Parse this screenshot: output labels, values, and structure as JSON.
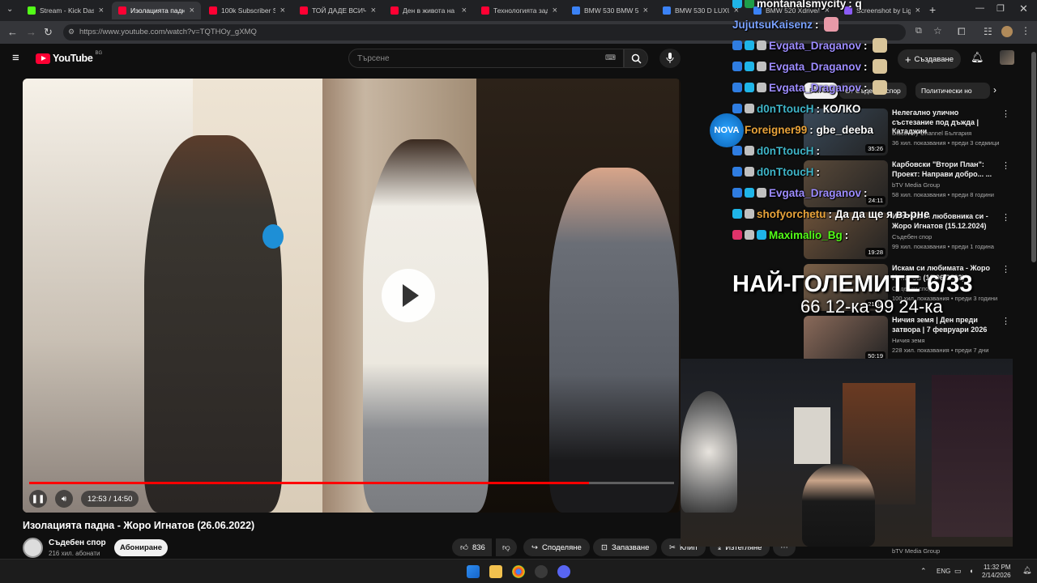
{
  "browser": {
    "tabs": [
      {
        "title": "Stream - Kick Dashb",
        "color": "#53fc18"
      },
      {
        "title": "Изолацията падна",
        "color": "#ff0033"
      },
      {
        "title": "100k Subscriber Spe",
        "color": "#ff0033"
      },
      {
        "title": "ТОЙ ДАДЕ ВСИЧКО",
        "color": "#ff0033"
      },
      {
        "title": "Ден в живота на 22",
        "color": "#ff0033"
      },
      {
        "title": "Технологията зад U",
        "color": "#ff0033"
      },
      {
        "title": "BMW 530 BMW 530",
        "color": "#3b82f6"
      },
      {
        "title": "BMW 530 D LUXURY",
        "color": "#3b82f6"
      },
      {
        "title": "BMW 520 Xdrive/N",
        "color": "#3b82f6"
      },
      {
        "title": "Screenshot by Light",
        "color": "#8b5cf6"
      }
    ],
    "url": "https://www.youtube.com/watch?v=TQTHOy_gXMQ"
  },
  "youtube": {
    "logo_text": "YouTube",
    "logo_region": "BG",
    "search_placeholder": "Търсене",
    "create_label": "Създаване"
  },
  "video": {
    "time": "12:53 / 14:50",
    "progress_fraction": 0.868,
    "title": "Изолацията падна - Жоро Игнатов (26.06.2022)",
    "channel": "Съдебен спор",
    "subscribers": "216 хил. абонати",
    "subscribe_label": "Абониране",
    "likes": "836",
    "share_label": "Споделяне",
    "save_label": "Запазване",
    "clip_label": "Клип",
    "download_label": "Изтегляне"
  },
  "chips": [
    "Всички",
    "От Съдебен спор",
    "Политически но"
  ],
  "recommendations": [
    {
      "title": "Нелегално улично състезание под дъжда | Катаджии",
      "channel": "Discovery Channel България",
      "meta": "36 хил. показвания • преди 3 седмици",
      "duration": "35:26",
      "thumb": "#3a4a5a"
    },
    {
      "title": "Карбовски \"Втори План\": Проект: Направи добро... ...",
      "channel": "bTV Media Group",
      "meta": "58 хил. показвания • преди 8 години",
      "duration": "24:11",
      "thumb": "#5a4a3a"
    },
    {
      "title": "Изоставил любовника си - Жоро Игнатов (15.12.2024)",
      "channel": "Съдебен спор",
      "meta": "99 хил. показвания • преди 1 година",
      "duration": "19:28",
      "thumb": "#6a5038"
    },
    {
      "title": "Искам си любимата - Жоро Игнатов (12.06.2022)",
      "channel": "Съдебен спор",
      "meta": "100 хил. показвания • преди 3 години",
      "duration": "21:49",
      "thumb": "#7a6048"
    },
    {
      "title": "Ничия земя | Ден преди затвора | 7 февруари 2026",
      "channel": "Ничия земя",
      "meta": "228 хил. показвания • преди 7 дни",
      "duration": "50:19",
      "thumb": "#8a6a5a"
    }
  ],
  "last_rec_channel": "bTV Media Group",
  "chat": [
    {
      "user": "montanalsmycity",
      "msg": ": q",
      "color": "#ffffff",
      "badges": [
        "#1fb5e8",
        "#1e9e4a"
      ]
    },
    {
      "user": "JujutsuKaisenz",
      "msg": ":",
      "color": "#7aa2ff",
      "badges": [],
      "emote": "#e89aa8"
    },
    {
      "user": "Evgata_Draganov",
      "msg": ":",
      "color": "#9d8cff",
      "badges": [
        "#2f7de1",
        "#1fb5e8",
        "#c0c0c0"
      ],
      "emote": "#d9c59a"
    },
    {
      "user": "Evgata_Draganov",
      "msg": ":",
      "color": "#9d8cff",
      "badges": [
        "#2f7de1",
        "#1fb5e8",
        "#c0c0c0"
      ],
      "emote": "#d9c59a"
    },
    {
      "user": "Evgata_Draganov",
      "msg": ":",
      "color": "#9d8cff",
      "badges": [
        "#2f7de1",
        "#1fb5e8",
        "#c0c0c0"
      ],
      "emote": "#d9c59a"
    },
    {
      "user": "d0nTtoucH",
      "msg": ": КОЛКО",
      "color": "#3fb5c8",
      "badges": [
        "#2f7de1",
        "#c0c0c0"
      ]
    },
    {
      "user": "Foreigner99",
      "msg": ": gbe_deeba",
      "color": "#e8a33a",
      "badges": [
        "#c0c0c0"
      ]
    },
    {
      "user": "d0nTtoucH",
      "msg": ":",
      "color": "#3fb5c8",
      "badges": [
        "#2f7de1",
        "#c0c0c0"
      ]
    },
    {
      "user": "d0nTtoucH",
      "msg": ":",
      "color": "#3fb5c8",
      "badges": [
        "#2f7de1",
        "#c0c0c0"
      ]
    },
    {
      "user": "Evgata_Draganov",
      "msg": ":",
      "color": "#9d8cff",
      "badges": [
        "#2f7de1",
        "#1fb5e8",
        "#c0c0c0"
      ]
    },
    {
      "user": "shofyorchetu",
      "msg": ": Да да ще я върне",
      "color": "#e8a33a",
      "badges": [
        "#1fb5e8",
        "#c0c0c0"
      ]
    },
    {
      "user": "Maximalio_Bg",
      "msg": ":",
      "color": "#53fc18",
      "badges": [
        "#e0336a",
        "#c0c0c0",
        "#1fb5e8"
      ]
    }
  ],
  "overlay": {
    "title": "НАЙ-ГОЛЕМИТЕ 6/33",
    "subtitle": "66 12-ка 99 24-ка",
    "nova_logo": "NOVA"
  },
  "taskbar": {
    "lang": "ENG",
    "time": "11:32 PM",
    "date": "2/14/2026"
  }
}
